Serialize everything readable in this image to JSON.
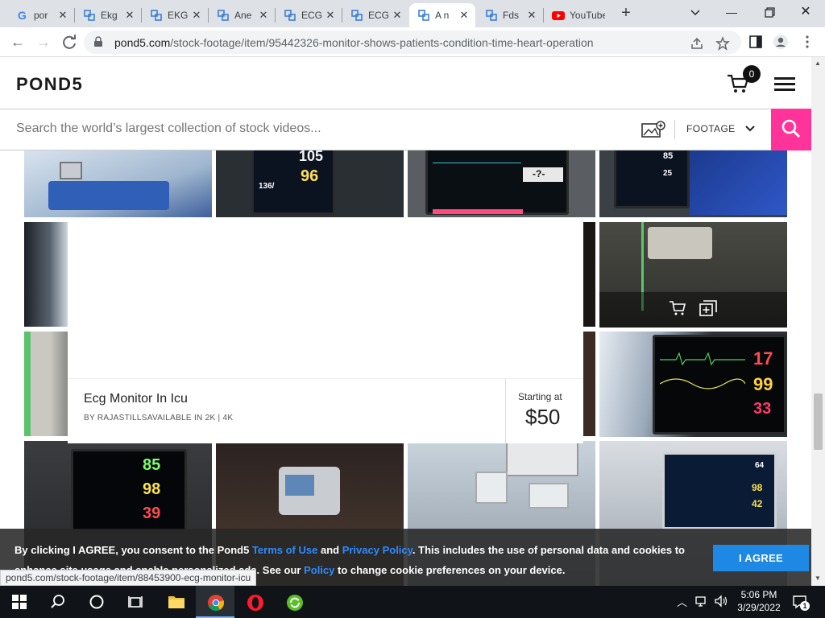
{
  "browser": {
    "tabs": [
      {
        "label": "por",
        "favicon": "google-icon"
      },
      {
        "label": "Ekg",
        "favicon": "pond5-icon"
      },
      {
        "label": "EKG",
        "favicon": "pond5-icon"
      },
      {
        "label": "Ane",
        "favicon": "pond5-icon"
      },
      {
        "label": "ECG",
        "favicon": "pond5-icon"
      },
      {
        "label": "ECG",
        "favicon": "pond5-icon"
      },
      {
        "label": "A n",
        "favicon": "pond5-icon",
        "active": true
      },
      {
        "label": "Fds",
        "favicon": "pond5-icon"
      },
      {
        "label": "YouTube",
        "favicon": "youtube-icon"
      }
    ],
    "url_host": "pond5.com",
    "url_path": "/stock-footage/item/95442326-monitor-shows-patients-condition-time-heart-operation",
    "status_url": "pond5.com/stock-footage/item/88453900-ecg-monitor-icu"
  },
  "site": {
    "logo": "POND5",
    "cart_count": "0",
    "search_placeholder": "Search the world’s largest collection of stock videos...",
    "filter_label": "FOOTAGE",
    "brand_color": "#ff3399"
  },
  "card": {
    "title": "Ecg Monitor In Icu",
    "meta": "BY RAJASTILLSAVAILABLE IN 2K | 4K",
    "starting_label": "Starting at",
    "price": "$50"
  },
  "grid": {
    "monitor_values": {
      "row1_b": [
        "105",
        "96",
        "136/"
      ],
      "row1_c": [
        "-?-"
      ],
      "row1_d": [
        "85",
        "25"
      ],
      "row3_d": [
        "17",
        "99",
        "33"
      ],
      "row4_a": [
        "85",
        "98",
        "39"
      ],
      "row4_d": [
        "64",
        "98",
        "42"
      ]
    }
  },
  "cookie": {
    "part1": "By clicking I AGREE, you consent to the Pond5 ",
    "terms": "Terms of Use",
    "and": " and ",
    "privacy": "Privacy Policy",
    "part2": ". This includes the use of personal data and cookies to enhance site usage and enable personalized ads. See our ",
    "policy": "Policy",
    "part3": " to change cookie preferences on your device.",
    "agree": "I AGREE"
  },
  "taskbar": {
    "time": "5:06 PM",
    "date": "3/29/2022",
    "notification_count": "1"
  }
}
